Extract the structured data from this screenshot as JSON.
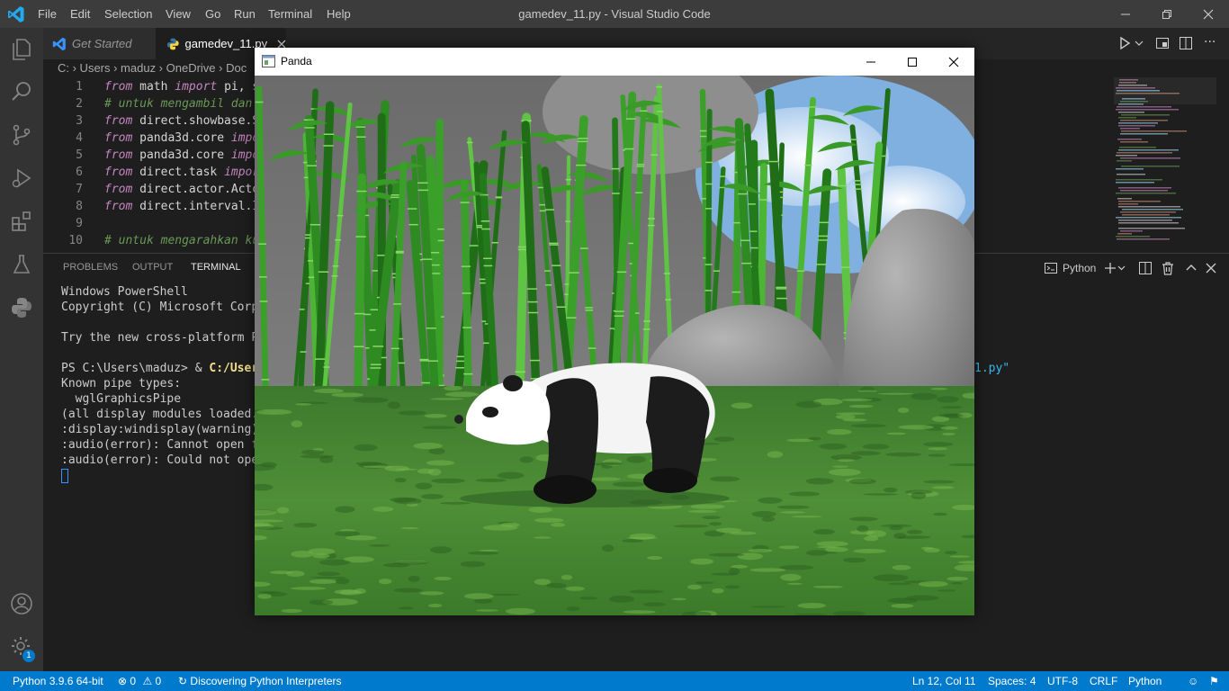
{
  "window_title": "gamedev_11.py - Visual Studio Code",
  "menu": [
    "File",
    "Edit",
    "Selection",
    "View",
    "Go",
    "Run",
    "Terminal",
    "Help"
  ],
  "tabs": [
    {
      "label": "Get Started"
    },
    {
      "label": "gamedev_11.py"
    }
  ],
  "breadcrumb": "C: › Users › maduz › OneDrive › Doc",
  "code_lines": [
    {
      "n": "1",
      "kw": "from",
      "rest": " math ",
      "kw2": "import",
      "rest2": " pi, s"
    },
    {
      "n": "2",
      "comment": "# untuk mengambil dan"
    },
    {
      "n": "3",
      "kw": "from",
      "rest": " direct.showbase.S"
    },
    {
      "n": "4",
      "kw": "from",
      "rest": " panda3d.core ",
      "kw2": "impo"
    },
    {
      "n": "5",
      "kw": "from",
      "rest": " panda3d.core ",
      "kw2": "impo"
    },
    {
      "n": "6",
      "kw": "from",
      "rest": " direct.task ",
      "kw2": "impor"
    },
    {
      "n": "7",
      "kw": "from",
      "rest": " direct.actor.Acto"
    },
    {
      "n": "8",
      "kw": "from",
      "rest": " direct.interval.I"
    },
    {
      "n": "9"
    },
    {
      "n": "10",
      "comment": "# untuk mengarahkan ku"
    }
  ],
  "panel": {
    "tabs": [
      "PROBLEMS",
      "OUTPUT",
      "TERMINAL"
    ],
    "active_tab": "TERMINAL",
    "shell": "Python"
  },
  "terminal_lines": [
    "Windows PowerShell",
    "Copyright (C) Microsoft Corpora",
    "",
    "Try the new cross-platform Powe",
    "",
    "PS C:\\Users\\maduz> & ",
    "Known pipe types:",
    "  wglGraphicsPipe",
    "(all display modules loaded.)",
    ":display:windisplay(warning): S",
    ":audio(error): Cannot open file",
    ":audio(error): Could not open a"
  ],
  "terminal_cmd_path": "C:/Users/m",
  "terminal_cmd_tail": "1.py\"",
  "statusbar": {
    "python": "Python 3.9.6 64-bit",
    "errors": "0",
    "warnings": "0",
    "discovering": "Discovering Python Interpreters",
    "position": "Ln 12, Col 11",
    "spaces": "Spaces: 4",
    "encoding": "UTF-8",
    "eol": "CRLF",
    "language": "Python"
  },
  "settings_badge": "1",
  "panda_window": {
    "title": "Panda"
  },
  "colors": {
    "titlebar": "#3c3c3c",
    "activitybar": "#333333",
    "editor_bg": "#1e1e1e",
    "statusbar": "#007acc",
    "keyword": "#c586c0",
    "comment": "#6a9955"
  }
}
